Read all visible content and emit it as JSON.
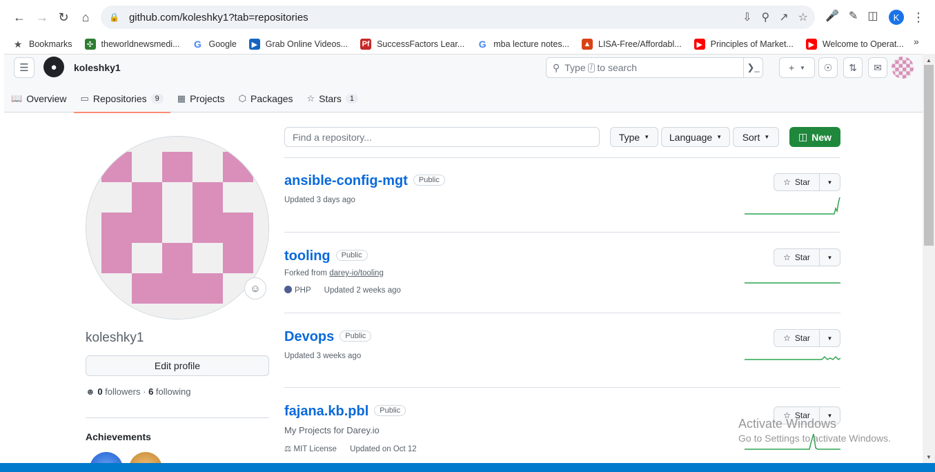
{
  "browser": {
    "url": "github.com/koleshky1?tab=repositories",
    "profile_initial": "K",
    "bookmarks": [
      {
        "label": "Bookmarks",
        "icon": "star-icon",
        "color": "#555555"
      },
      {
        "label": "theworldnewsmedi...",
        "icon": "pinwheel-icon",
        "color": "#2e7d32"
      },
      {
        "label": "Google",
        "icon": "google-icon",
        "color": "#4285f4"
      },
      {
        "label": "Grab Online Videos...",
        "icon": "video-icon",
        "color": "#1565c0"
      },
      {
        "label": "SuccessFactors Lear...",
        "icon": "pf-icon",
        "color": "#c62828"
      },
      {
        "label": "mba lecture notes...",
        "icon": "google-icon",
        "color": "#4285f4"
      },
      {
        "label": "LISA-Free/Affordabl...",
        "icon": "lisa-icon",
        "color": "#d84315"
      },
      {
        "label": "Principles of Market...",
        "icon": "youtube-icon",
        "color": "#ff0000"
      },
      {
        "label": "Welcome to Operat...",
        "icon": "youtube-icon",
        "color": "#ff0000"
      }
    ]
  },
  "github": {
    "username": "koleshky1",
    "search_prefix": "Type",
    "search_slash": "/",
    "search_suffix": "to search",
    "tabs": [
      {
        "label": "Overview",
        "icon": "book-icon",
        "count": null
      },
      {
        "label": "Repositories",
        "icon": "repo-icon",
        "count": "9"
      },
      {
        "label": "Projects",
        "icon": "table-icon",
        "count": null
      },
      {
        "label": "Packages",
        "icon": "package-icon",
        "count": null
      },
      {
        "label": "Stars",
        "icon": "star-icon",
        "count": "1"
      }
    ]
  },
  "profile": {
    "name": "koleshky1",
    "edit_label": "Edit profile",
    "followers": "0",
    "followers_label": "followers",
    "separator": "·",
    "following": "6",
    "following_label": "following",
    "achievements_label": "Achievements"
  },
  "filters": {
    "placeholder": "Find a repository...",
    "type_label": "Type",
    "language_label": "Language",
    "sort_label": "Sort",
    "new_label": "New"
  },
  "repos": [
    {
      "name": "ansible-config-mgt",
      "visibility": "Public",
      "updated": "Updated 3 days ago",
      "star_label": "Star"
    },
    {
      "name": "tooling",
      "visibility": "Public",
      "forked_prefix": "Forked from",
      "forked_from": "darey-io/tooling",
      "language": "PHP",
      "language_color": "#4F5D95",
      "updated": "Updated 2 weeks ago",
      "star_label": "Star"
    },
    {
      "name": "Devops",
      "visibility": "Public",
      "updated": "Updated 3 weeks ago",
      "star_label": "Star"
    },
    {
      "name": "fajana.kb.pbl",
      "visibility": "Public",
      "description": "My Projects for Darey.io",
      "license": "MIT License",
      "updated": "Updated on Oct 12",
      "star_label": "Star"
    }
  ],
  "watermark": {
    "line1": "Activate Windows",
    "line2": "Go to Settings to activate Windows."
  },
  "colors": {
    "accent_green": "#1f883d",
    "link_blue": "#0969da",
    "identicon_pink": "#d98fba",
    "spark_green": "#2da44e"
  }
}
